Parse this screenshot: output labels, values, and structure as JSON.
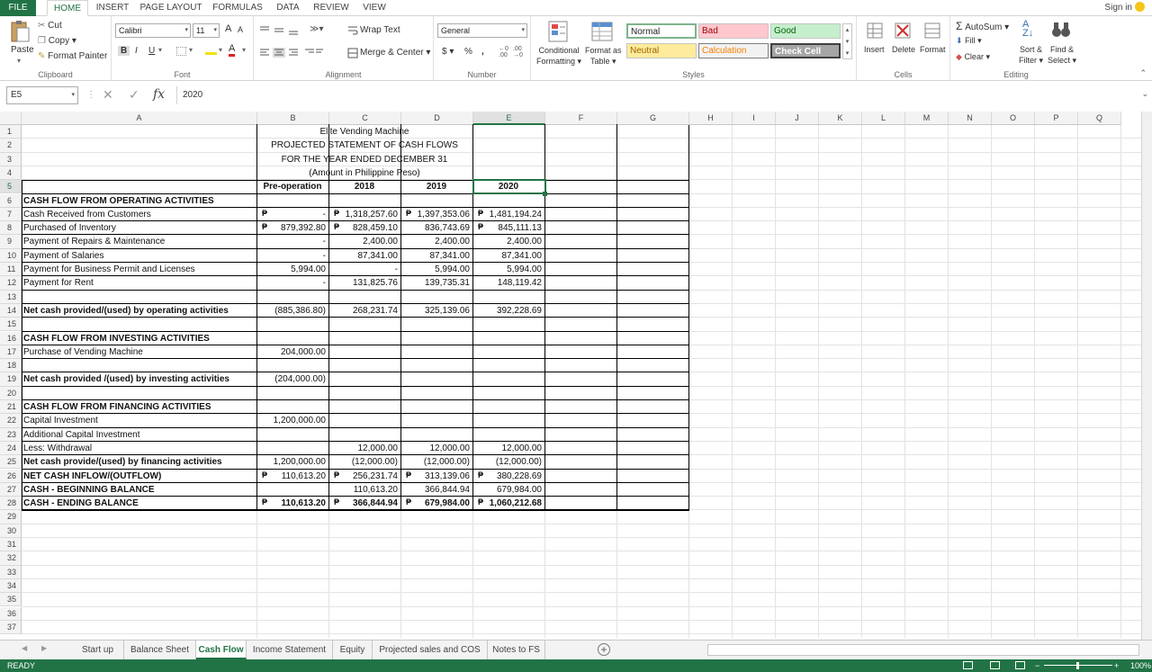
{
  "menu": {
    "file": "FILE",
    "tabs": [
      "HOME",
      "INSERT",
      "PAGE LAYOUT",
      "FORMULAS",
      "DATA",
      "REVIEW",
      "VIEW"
    ],
    "signin": "Sign in"
  },
  "ribbon": {
    "clipboard": {
      "paste": "Paste",
      "cut": "Cut",
      "copy": "Copy",
      "format_painter": "Format Painter",
      "label": "Clipboard"
    },
    "font": {
      "name": "Calibri",
      "size": "11",
      "bold": "B",
      "italic": "I",
      "underline": "U",
      "grow": "A",
      "shrink": "A",
      "label": "Font"
    },
    "alignment": {
      "wrap": "Wrap Text",
      "merge": "Merge & Center",
      "label": "Alignment"
    },
    "number": {
      "format": "General",
      "currency": "$",
      "percent": "%",
      "comma": ",",
      "label": "Number"
    },
    "styles": {
      "conditional": "Conditional",
      "formatting": "Formatting",
      "format_as": "Format as",
      "table": "Table",
      "normal": "Normal",
      "bad": "Bad",
      "good": "Good",
      "neutral": "Neutral",
      "calculation": "Calculation",
      "check_cell": "Check Cell",
      "label": "Styles"
    },
    "cells": {
      "insert": "Insert",
      "delete": "Delete",
      "format": "Format",
      "label": "Cells"
    },
    "editing": {
      "autosum": "AutoSum",
      "fill": "Fill",
      "clear": "Clear",
      "sort": "Sort &",
      "filter": "Filter",
      "find": "Find &",
      "select": "Select",
      "label": "Editing"
    }
  },
  "formula_bar": {
    "name_box": "E5",
    "fx": "fx",
    "value": "2020"
  },
  "columns": [
    "A",
    "B",
    "C",
    "D",
    "E",
    "F",
    "G",
    "H",
    "I",
    "J",
    "K",
    "L",
    "M",
    "N",
    "O",
    "P",
    "Q"
  ],
  "rows": [
    "1",
    "2",
    "3",
    "4",
    "5",
    "6",
    "7",
    "8",
    "9",
    "10",
    "11",
    "12",
    "13",
    "14",
    "15",
    "16",
    "17",
    "18",
    "19",
    "20",
    "21",
    "22",
    "23",
    "24",
    "25",
    "26",
    "27",
    "28",
    "29",
    "30",
    "31",
    "32",
    "33",
    "34",
    "35",
    "36",
    "37"
  ],
  "title": {
    "company": "Elite Vending Machine",
    "statement": "PROJECTED STATEMENT OF CASH FLOWS",
    "period": "FOR THE YEAR ENDED DECEMBER 31",
    "currency": "(Amount in Philippine Peso)"
  },
  "headers": [
    "Pre-operation",
    "2018",
    "2019",
    "2020"
  ],
  "currency_symbol": "₱",
  "lines": [
    {
      "row": 6,
      "label": "CASH FLOW FROM OPERATING ACTIVITIES",
      "bold": true,
      "values": [
        "",
        "",
        "",
        ""
      ]
    },
    {
      "row": 7,
      "label": "Cash Received from Customers",
      "bold": false,
      "values": [
        "-",
        "1,318,257.60",
        "1,397,353.06",
        "1,481,194.24"
      ],
      "peso": [
        true,
        true,
        true,
        true
      ]
    },
    {
      "row": 8,
      "label": "Purchased of Inventory",
      "bold": false,
      "values": [
        "879,392.80",
        "828,459.10",
        "836,743.69",
        "845,111.13"
      ],
      "peso": [
        true,
        true,
        false,
        true
      ]
    },
    {
      "row": 9,
      "label": "Payment of Repairs & Maintenance",
      "bold": false,
      "values": [
        "-",
        "2,400.00",
        "2,400.00",
        "2,400.00"
      ]
    },
    {
      "row": 10,
      "label": "Payment of Salaries",
      "bold": false,
      "values": [
        "-",
        "87,341.00",
        "87,341.00",
        "87,341.00"
      ]
    },
    {
      "row": 11,
      "label": "Payment for Business Permit and Licenses",
      "bold": false,
      "values": [
        "5,994.00",
        "-",
        "5,994.00",
        "5,994.00"
      ]
    },
    {
      "row": 12,
      "label": "Payment for Rent",
      "bold": false,
      "values": [
        "-",
        "131,825.76",
        "139,735.31",
        "148,119.42"
      ]
    },
    {
      "row": 14,
      "label": "Net cash provided/(used) by operating activities",
      "bold": true,
      "values": [
        "(885,386.80)",
        "268,231.74",
        "325,139.06",
        "392,228.69"
      ]
    },
    {
      "row": 16,
      "label": "CASH FLOW FROM INVESTING ACTIVITIES",
      "bold": true,
      "values": [
        "",
        "",
        "",
        ""
      ]
    },
    {
      "row": 17,
      "label": "Purchase of Vending Machine",
      "bold": false,
      "values": [
        "204,000.00",
        "",
        "",
        ""
      ]
    },
    {
      "row": 19,
      "label": "Net cash  provided /(used) by investing activities",
      "bold": true,
      "values": [
        "(204,000.00)",
        "",
        "",
        ""
      ]
    },
    {
      "row": 21,
      "label": "CASH FLOW FROM FINANCING ACTIVITIES",
      "bold": true,
      "values": [
        "",
        "",
        "",
        ""
      ]
    },
    {
      "row": 22,
      "label": "Capital Investment",
      "bold": false,
      "values": [
        "1,200,000.00",
        "",
        "",
        ""
      ]
    },
    {
      "row": 23,
      "label": "Additional Capital Investment",
      "bold": false,
      "values": [
        "",
        "",
        "",
        ""
      ]
    },
    {
      "row": 24,
      "label": "Less: Withdrawal",
      "bold": false,
      "values": [
        "",
        "12,000.00",
        "12,000.00",
        "12,000.00"
      ]
    },
    {
      "row": 25,
      "label": "Net cash provide/(used) by financing activities",
      "bold": true,
      "values": [
        "1,200,000.00",
        "(12,000.00)",
        "(12,000.00)",
        "(12,000.00)"
      ]
    },
    {
      "row": 26,
      "label": "NET CASH INFLOW/(OUTFLOW)",
      "bold": true,
      "values": [
        "110,613.20",
        "256,231.74",
        "313,139.06",
        "380,228.69"
      ],
      "peso": [
        true,
        true,
        true,
        true
      ]
    },
    {
      "row": 27,
      "label": "CASH - BEGINNING BALANCE",
      "bold": true,
      "values": [
        "",
        "110,613.20",
        "366,844.94",
        "679,984.00"
      ]
    },
    {
      "row": 28,
      "label": "CASH - ENDING BALANCE",
      "bold": true,
      "values": [
        "110,613.20",
        "366,844.94",
        "679,984.00",
        "1,060,212.68"
      ],
      "peso": [
        true,
        true,
        true,
        true
      ],
      "boldvals": true
    }
  ],
  "sheet_tabs": [
    "Start up",
    "Balance Sheet",
    "Cash Flow",
    "Income Statement",
    "Equity",
    "Projected sales and COS",
    "Notes to FS"
  ],
  "active_tab": "Cash Flow",
  "status": {
    "ready": "READY",
    "zoom": "100%"
  }
}
